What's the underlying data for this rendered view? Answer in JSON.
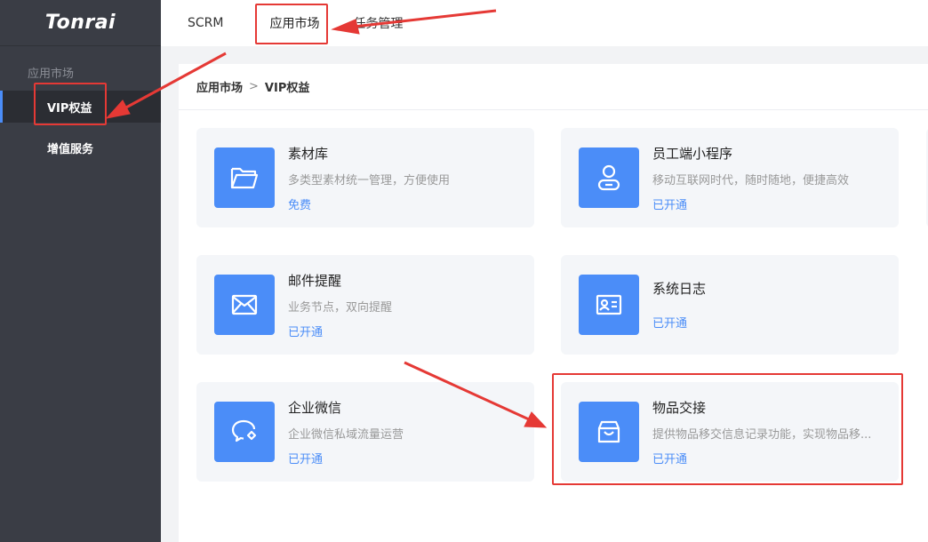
{
  "brand": {
    "name": "Tonrai"
  },
  "sidebar": {
    "group_label": "应用市场",
    "items": [
      {
        "label": "VIP权益"
      },
      {
        "label": "增值服务"
      }
    ]
  },
  "topbar": {
    "tabs": [
      {
        "label": "SCRM"
      },
      {
        "label": "应用市场"
      },
      {
        "label": "任务管理"
      }
    ]
  },
  "breadcrumb": {
    "root": "应用市场",
    "separator": ">",
    "current": "VIP权益"
  },
  "cards": [
    {
      "icon": "folder-icon",
      "title": "素材库",
      "desc": "多类型素材统一管理，方便使用",
      "status": "免费"
    },
    {
      "icon": "user-badge-icon",
      "title": "员工端小程序",
      "desc": "移动互联网时代，随时随地，便捷高效",
      "status": "已开通"
    },
    {
      "icon": "mail-icon",
      "title": "邮件提醒",
      "desc": "业务节点，双向提醒",
      "status": "已开通"
    },
    {
      "icon": "id-card-icon",
      "title": "系统日志",
      "desc": "",
      "status": "已开通"
    },
    {
      "icon": "wechat-bubble-icon",
      "title": "企业微信",
      "desc": "企业微信私域流量运营",
      "status": "已开通"
    },
    {
      "icon": "box-icon",
      "title": "物品交接",
      "desc": "提供物品移交信息记录功能，实现物品移...",
      "status": "已开通"
    }
  ],
  "colors": {
    "accent": "#4b8df8",
    "sidebar_bg": "#3a3d45",
    "annotation": "#e53935"
  }
}
